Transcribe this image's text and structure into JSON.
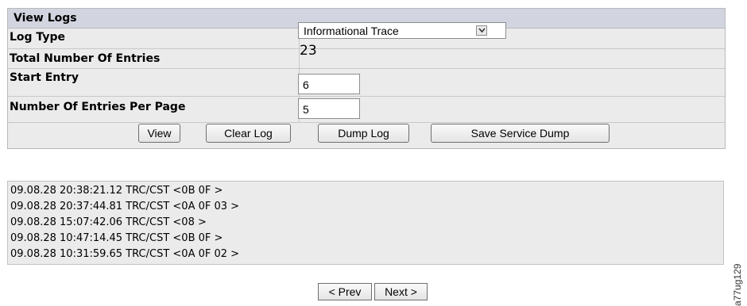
{
  "panel": {
    "title": "View Logs",
    "rows": {
      "log_type_label": "Log Type",
      "total_entries_label": "Total Number Of Entries",
      "start_entry_label": "Start Entry",
      "entries_per_page_label": "Number Of Entries Per Page"
    },
    "log_type_select": {
      "selected": "Informational Trace",
      "icon": "chevron-down-icon"
    },
    "total_entries_value": "23",
    "start_entry_value": "6",
    "entries_per_page_value": "5",
    "buttons": {
      "view": "View",
      "clear_log": "Clear Log",
      "dump_log": "Dump Log",
      "save_service_dump": "Save Service Dump"
    }
  },
  "log": {
    "lines": [
      "09.08.28 20:38:21.12 TRC/CST <0B 0F >",
      "09.08.28 20:37:44.81 TRC/CST <0A 0F 03 >",
      "09.08.28 15:07:42.06 TRC/CST <08 >",
      "09.08.28 10:47:14.45 TRC/CST <0B 0F >",
      "09.08.28 10:31:59.65 TRC/CST <0A 0F 02 >"
    ]
  },
  "pager": {
    "prev": "< Prev",
    "next": "Next >"
  },
  "side_label": "a77ug129"
}
